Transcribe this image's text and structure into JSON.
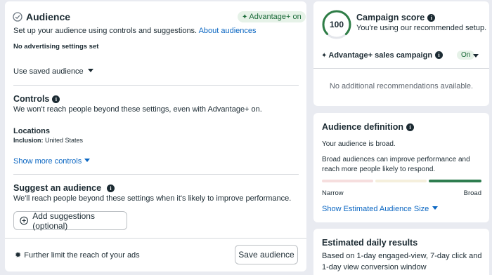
{
  "audience": {
    "title": "Audience",
    "advantage_badge": "Advantage+ on",
    "subtitle": "Set up your audience using controls and suggestions.",
    "about_link": "About audiences",
    "no_ad_settings": "No advertising settings set",
    "saved_audience_label": "Use saved audience"
  },
  "controls": {
    "title": "Controls",
    "description": "We won't reach people beyond these settings, even with Advantage+ on.",
    "locations_title": "Locations",
    "inclusion_label": "Inclusion:",
    "inclusion_value": "United States",
    "show_more": "Show more controls"
  },
  "suggest": {
    "title": "Suggest an audience",
    "description": "We'll reach people beyond these settings when it's likely to improve performance.",
    "add_button": "Add suggestions (optional)"
  },
  "footer": {
    "further_limit": "Further limit the reach of your ads",
    "save_button": "Save audience"
  },
  "campaign_score": {
    "value": "100",
    "value_fraction": 1.0,
    "title": "Campaign score",
    "subtitle": "You're using our recommended setup.",
    "sales_campaign": "Advantage+ sales campaign",
    "toggle_state": "On",
    "no_recs": "No additional recommendations available."
  },
  "audience_definition": {
    "title": "Audience definition",
    "status": "Your audience is broad.",
    "description": "Broad audiences can improve performance and reach more people likely to respond.",
    "narrow_label": "Narrow",
    "broad_label": "Broad",
    "show_size": "Show Estimated Audience Size"
  },
  "estimated": {
    "title": "Estimated daily results",
    "description": "Based on 1-day engaged-view, 7-day click and 1-day view conversion window"
  },
  "colors": {
    "accent_link": "#0a66c2",
    "score_ring": "#2e7d46",
    "badge_bg": "#e6f2e8",
    "badge_text": "#1c6b3a",
    "meter_narrow": "#f6dede",
    "meter_mid": "#f5efdc",
    "meter_broad": "#2e7d4f"
  }
}
